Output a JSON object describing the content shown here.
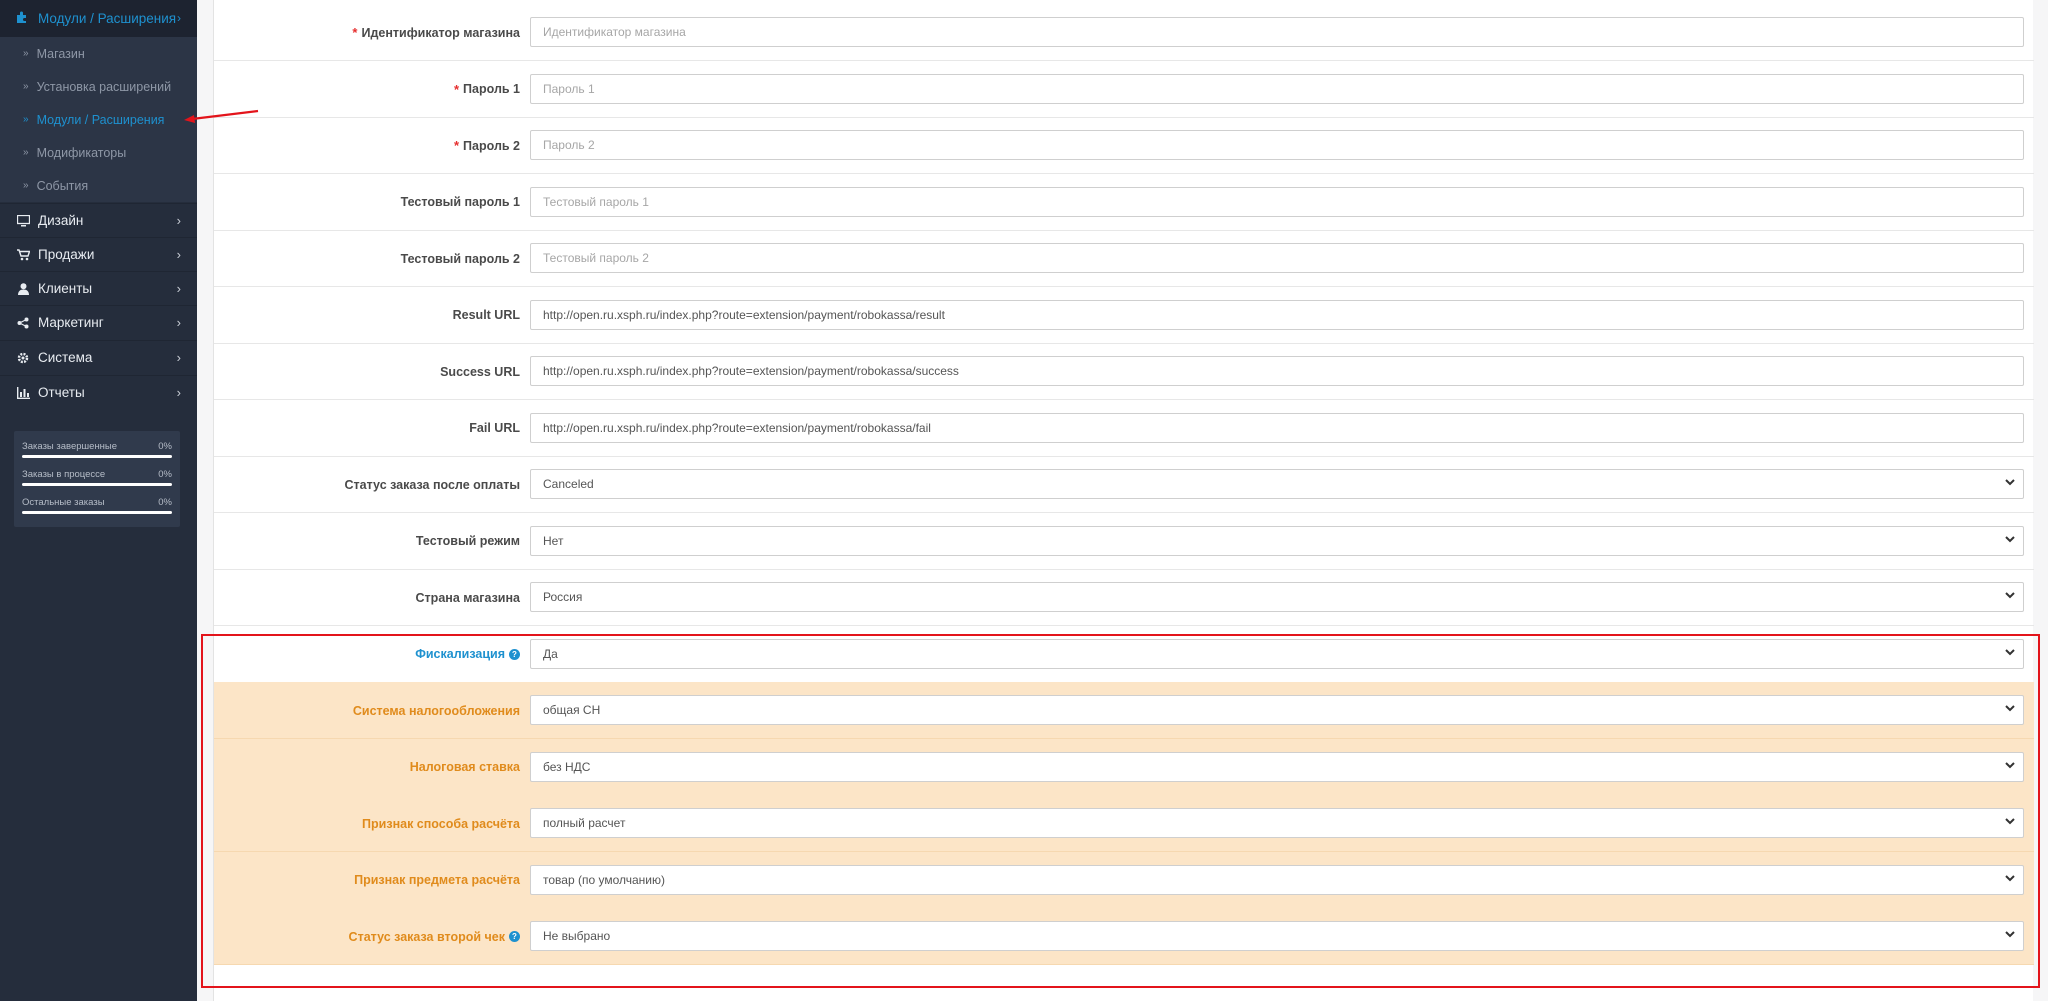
{
  "sidebar": {
    "active_section": {
      "label": "Модули / Расширения",
      "icon": "puzzle-icon"
    },
    "sub_items": [
      {
        "label": "Магазин"
      },
      {
        "label": "Установка расширений"
      },
      {
        "label": "Модули / Расширения",
        "current": true
      },
      {
        "label": "Модификаторы"
      },
      {
        "label": "События"
      }
    ],
    "main_items": [
      {
        "label": "Дизайн",
        "icon": "monitor-icon"
      },
      {
        "label": "Продажи",
        "icon": "cart-icon"
      },
      {
        "label": "Клиенты",
        "icon": "user-icon"
      },
      {
        "label": "Маркетинг",
        "icon": "share-icon"
      },
      {
        "label": "Система",
        "icon": "gear-icon"
      },
      {
        "label": "Отчеты",
        "icon": "bar-chart-icon"
      }
    ],
    "stats": [
      {
        "label": "Заказы завершенные",
        "value": "0%"
      },
      {
        "label": "Заказы в процессе",
        "value": "0%"
      },
      {
        "label": "Остальные заказы",
        "value": "0%"
      }
    ]
  },
  "form": {
    "rows": [
      {
        "label": "Идентификатор магазина",
        "required": true,
        "type": "input",
        "value": "",
        "placeholder": "Идентификатор магазина"
      },
      {
        "label": "Пароль 1",
        "required": true,
        "type": "input",
        "value": "",
        "placeholder": "Пароль 1"
      },
      {
        "label": "Пароль 2",
        "required": true,
        "type": "input",
        "value": "",
        "placeholder": "Пароль 2"
      },
      {
        "label": "Тестовый пароль 1",
        "type": "input",
        "value": "",
        "placeholder": "Тестовый пароль 1"
      },
      {
        "label": "Тестовый пароль 2",
        "type": "input",
        "value": "",
        "placeholder": "Тестовый пароль 2"
      },
      {
        "label": "Result URL",
        "type": "input",
        "value": "http://open.ru.xsph.ru/index.php?route=extension/payment/robokassa/result"
      },
      {
        "label": "Success URL",
        "type": "input",
        "value": "http://open.ru.xsph.ru/index.php?route=extension/payment/robokassa/success"
      },
      {
        "label": "Fail URL",
        "type": "input",
        "value": "http://open.ru.xsph.ru/index.php?route=extension/payment/robokassa/fail"
      },
      {
        "label": "Статус заказа после оплаты",
        "type": "select",
        "value": "Canceled"
      },
      {
        "label": "Тестовый режим",
        "type": "select",
        "value": "Нет"
      },
      {
        "label": "Страна магазина",
        "type": "select",
        "value": "Россия"
      },
      {
        "label": "Фискализация",
        "type": "select",
        "value": "Да",
        "help": true,
        "style": "fiscal"
      },
      {
        "label": "Система налогообложения",
        "type": "select",
        "value": "общая СН",
        "style": "orange"
      },
      {
        "label": "Налоговая ставка",
        "type": "select",
        "value": "без НДС",
        "style": "orange"
      },
      {
        "label": "Признак способа расчёта",
        "type": "select",
        "value": "полный расчет",
        "style": "orange"
      },
      {
        "label": "Признак предмета расчёта",
        "type": "select",
        "value": "товар (по умолчанию)",
        "style": "orange"
      },
      {
        "label": "Статус заказа второй чек",
        "type": "select",
        "value": "Не выбрано",
        "help": true,
        "style": "orange"
      }
    ]
  },
  "colors": {
    "sidebar_bg": "#252d3c",
    "accent": "#1e91cf",
    "required": "#e62e2e",
    "orange_row_bg": "#fce5c7",
    "orange_label": "#e08b1c",
    "highlight": "#e3141b"
  }
}
